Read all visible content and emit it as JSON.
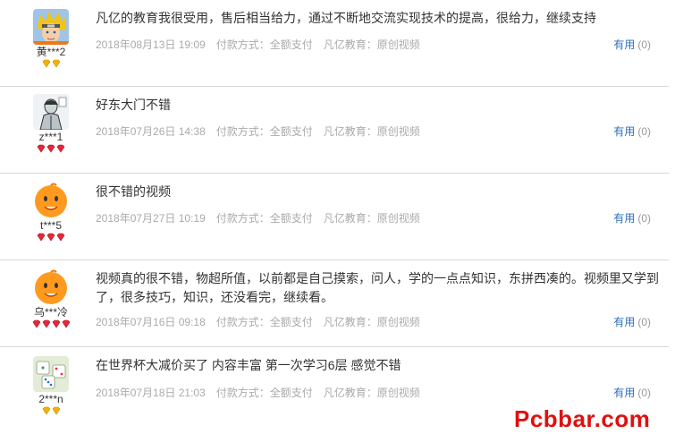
{
  "reviews": [
    {
      "user": "黄***2",
      "badge": "gold",
      "badge_count": 2,
      "avatar": "naruto-avatar",
      "content": "凡亿的教育我很受用，售后相当给力，通过不断地交流实现技术的提高，很给力，继续支持",
      "date": "2018年08月13日 19:09",
      "payment": "付款方式：全额支付",
      "edu": "凡亿教育：原创视频",
      "useful": "有用",
      "count": "(0)"
    },
    {
      "user": "z***1",
      "badge": "red",
      "badge_count": 3,
      "avatar": "sketch-avatar",
      "content": "好东大门不错",
      "date": "2018年07月26日 14:38",
      "payment": "付款方式：全额支付",
      "edu": "凡亿教育：原创视频",
      "useful": "有用",
      "count": "(0)"
    },
    {
      "user": "t***5",
      "badge": "red",
      "badge_count": 3,
      "avatar": "orange-mascot-avatar",
      "content": "很不错的视频",
      "date": "2018年07月27日 10:19",
      "payment": "付款方式：全额支付",
      "edu": "凡亿教育：原创视频",
      "useful": "有用",
      "count": "(0)"
    },
    {
      "user": "乌***冷",
      "badge": "red",
      "badge_count": 4,
      "avatar": "orange-mascot-avatar",
      "content": "视频真的很不错，物超所值，以前都是自己摸索，问人，学的一点点知识，东拼西凑的。视频里又学到了，很多技巧，知识，还没看完，继续看。",
      "date": "2018年07月16日 09:18",
      "payment": "付款方式：全额支付",
      "edu": "凡亿教育：原创视频",
      "useful": "有用",
      "count": "(0)"
    },
    {
      "user": "2***n",
      "badge": "gold",
      "badge_count": 2,
      "avatar": "dice-avatar",
      "content": "在世界杯大减价买了 内容丰富 第一次学习6层 感觉不错",
      "date": "2018年07月18日 21:03",
      "payment": "付款方式：全额支付",
      "edu": "凡亿教育：原创视频",
      "useful": "有用",
      "count": "(0)"
    }
  ],
  "watermark": "Pcbbar.com",
  "colors": {
    "link": "#2a6ebb",
    "gold": "#f3b400",
    "red": "#e8263a",
    "watermark": "#e01010"
  }
}
